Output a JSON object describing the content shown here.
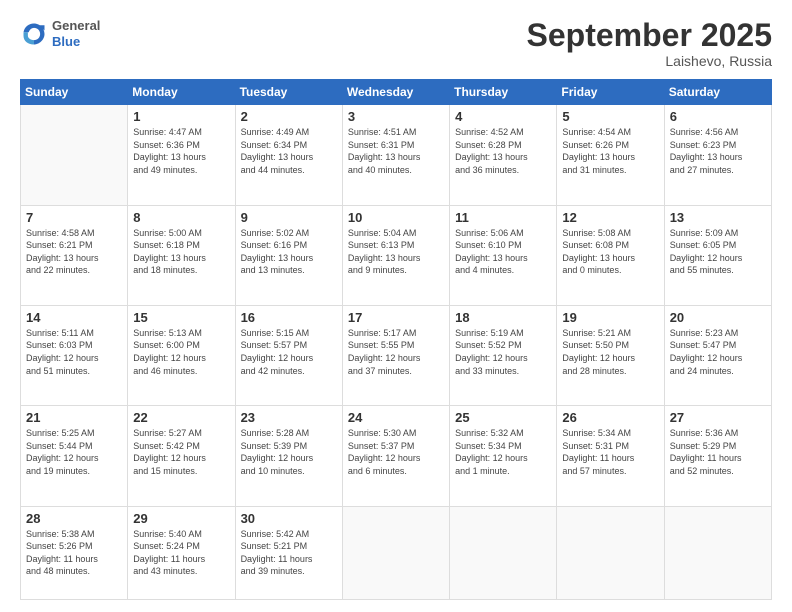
{
  "header": {
    "logo": {
      "general": "General",
      "blue": "Blue"
    },
    "month": "September 2025",
    "location": "Laishevo, Russia"
  },
  "weekdays": [
    "Sunday",
    "Monday",
    "Tuesday",
    "Wednesday",
    "Thursday",
    "Friday",
    "Saturday"
  ],
  "weeks": [
    [
      {
        "day": "",
        "info": ""
      },
      {
        "day": "1",
        "info": "Sunrise: 4:47 AM\nSunset: 6:36 PM\nDaylight: 13 hours\nand 49 minutes."
      },
      {
        "day": "2",
        "info": "Sunrise: 4:49 AM\nSunset: 6:34 PM\nDaylight: 13 hours\nand 44 minutes."
      },
      {
        "day": "3",
        "info": "Sunrise: 4:51 AM\nSunset: 6:31 PM\nDaylight: 13 hours\nand 40 minutes."
      },
      {
        "day": "4",
        "info": "Sunrise: 4:52 AM\nSunset: 6:28 PM\nDaylight: 13 hours\nand 36 minutes."
      },
      {
        "day": "5",
        "info": "Sunrise: 4:54 AM\nSunset: 6:26 PM\nDaylight: 13 hours\nand 31 minutes."
      },
      {
        "day": "6",
        "info": "Sunrise: 4:56 AM\nSunset: 6:23 PM\nDaylight: 13 hours\nand 27 minutes."
      }
    ],
    [
      {
        "day": "7",
        "info": "Sunrise: 4:58 AM\nSunset: 6:21 PM\nDaylight: 13 hours\nand 22 minutes."
      },
      {
        "day": "8",
        "info": "Sunrise: 5:00 AM\nSunset: 6:18 PM\nDaylight: 13 hours\nand 18 minutes."
      },
      {
        "day": "9",
        "info": "Sunrise: 5:02 AM\nSunset: 6:16 PM\nDaylight: 13 hours\nand 13 minutes."
      },
      {
        "day": "10",
        "info": "Sunrise: 5:04 AM\nSunset: 6:13 PM\nDaylight: 13 hours\nand 9 minutes."
      },
      {
        "day": "11",
        "info": "Sunrise: 5:06 AM\nSunset: 6:10 PM\nDaylight: 13 hours\nand 4 minutes."
      },
      {
        "day": "12",
        "info": "Sunrise: 5:08 AM\nSunset: 6:08 PM\nDaylight: 13 hours\nand 0 minutes."
      },
      {
        "day": "13",
        "info": "Sunrise: 5:09 AM\nSunset: 6:05 PM\nDaylight: 12 hours\nand 55 minutes."
      }
    ],
    [
      {
        "day": "14",
        "info": "Sunrise: 5:11 AM\nSunset: 6:03 PM\nDaylight: 12 hours\nand 51 minutes."
      },
      {
        "day": "15",
        "info": "Sunrise: 5:13 AM\nSunset: 6:00 PM\nDaylight: 12 hours\nand 46 minutes."
      },
      {
        "day": "16",
        "info": "Sunrise: 5:15 AM\nSunset: 5:57 PM\nDaylight: 12 hours\nand 42 minutes."
      },
      {
        "day": "17",
        "info": "Sunrise: 5:17 AM\nSunset: 5:55 PM\nDaylight: 12 hours\nand 37 minutes."
      },
      {
        "day": "18",
        "info": "Sunrise: 5:19 AM\nSunset: 5:52 PM\nDaylight: 12 hours\nand 33 minutes."
      },
      {
        "day": "19",
        "info": "Sunrise: 5:21 AM\nSunset: 5:50 PM\nDaylight: 12 hours\nand 28 minutes."
      },
      {
        "day": "20",
        "info": "Sunrise: 5:23 AM\nSunset: 5:47 PM\nDaylight: 12 hours\nand 24 minutes."
      }
    ],
    [
      {
        "day": "21",
        "info": "Sunrise: 5:25 AM\nSunset: 5:44 PM\nDaylight: 12 hours\nand 19 minutes."
      },
      {
        "day": "22",
        "info": "Sunrise: 5:27 AM\nSunset: 5:42 PM\nDaylight: 12 hours\nand 15 minutes."
      },
      {
        "day": "23",
        "info": "Sunrise: 5:28 AM\nSunset: 5:39 PM\nDaylight: 12 hours\nand 10 minutes."
      },
      {
        "day": "24",
        "info": "Sunrise: 5:30 AM\nSunset: 5:37 PM\nDaylight: 12 hours\nand 6 minutes."
      },
      {
        "day": "25",
        "info": "Sunrise: 5:32 AM\nSunset: 5:34 PM\nDaylight: 12 hours\nand 1 minute."
      },
      {
        "day": "26",
        "info": "Sunrise: 5:34 AM\nSunset: 5:31 PM\nDaylight: 11 hours\nand 57 minutes."
      },
      {
        "day": "27",
        "info": "Sunrise: 5:36 AM\nSunset: 5:29 PM\nDaylight: 11 hours\nand 52 minutes."
      }
    ],
    [
      {
        "day": "28",
        "info": "Sunrise: 5:38 AM\nSunset: 5:26 PM\nDaylight: 11 hours\nand 48 minutes."
      },
      {
        "day": "29",
        "info": "Sunrise: 5:40 AM\nSunset: 5:24 PM\nDaylight: 11 hours\nand 43 minutes."
      },
      {
        "day": "30",
        "info": "Sunrise: 5:42 AM\nSunset: 5:21 PM\nDaylight: 11 hours\nand 39 minutes."
      },
      {
        "day": "",
        "info": ""
      },
      {
        "day": "",
        "info": ""
      },
      {
        "day": "",
        "info": ""
      },
      {
        "day": "",
        "info": ""
      }
    ]
  ]
}
